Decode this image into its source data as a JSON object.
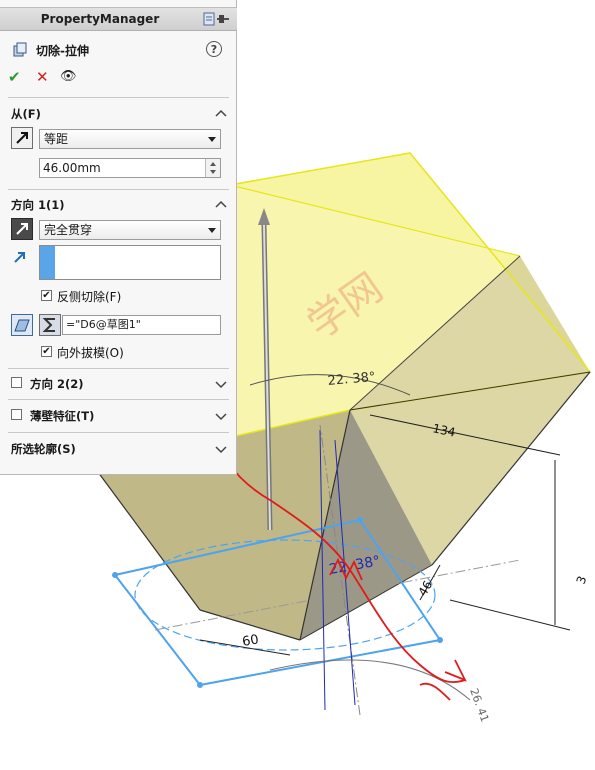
{
  "panel": {
    "header_title": "PropertyManager",
    "feature_title": "切除-拉伸",
    "help_glyph": "?",
    "actions": {
      "ok": "✔",
      "cancel": "✕",
      "preview": "👁"
    },
    "from_section": {
      "title": "从(F)",
      "mode_value": "等距",
      "offset_value": "46.00mm"
    },
    "direction1": {
      "title": "方向 1(1)",
      "end_condition": "完全贯穿",
      "flip_side_label": "反侧切除(F)",
      "flip_side_checked": true,
      "draft_value": "=\"D6@草图1\"",
      "draft_outward_label": "向外拔模(O)",
      "draft_outward_checked": true
    },
    "direction2": {
      "title": "方向 2(2)",
      "checked": false
    },
    "thin_feature": {
      "title": "薄壁特征(T)",
      "checked": false
    },
    "selected_contours": {
      "title": "所选轮廓(S)"
    }
  },
  "viewport": {
    "dimensions": {
      "angle_top": "22. 38°",
      "angle_lower": "22. 38°",
      "dim_134": "134",
      "dim_60": "60",
      "dim_46": "46",
      "dim_26": "26. 41",
      "dim_3": "3"
    },
    "watermark": "学网"
  },
  "colors": {
    "body_yellow": "#f5f38e",
    "body_edge": "#e8e820",
    "sketch_blue": "#4ea3ef",
    "annotation_red": "#e01b1b",
    "dim_blue": "#1e2bb0"
  }
}
